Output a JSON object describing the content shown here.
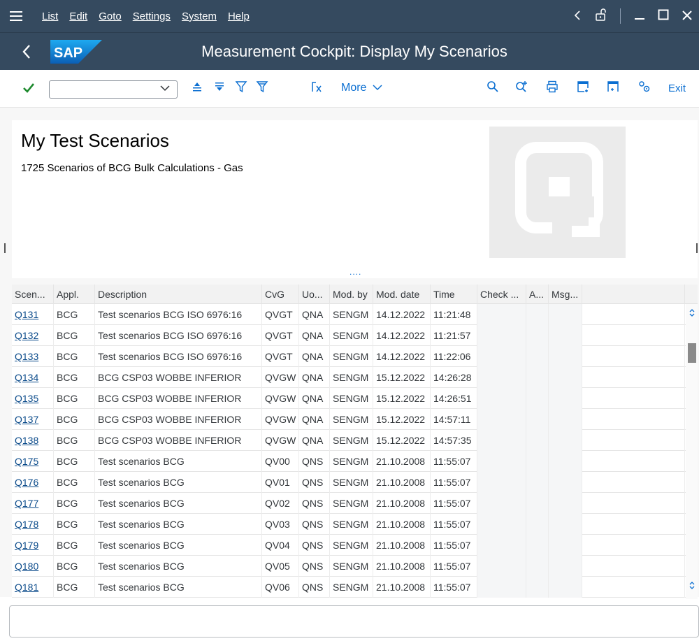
{
  "menu": {
    "items": [
      "List",
      "Edit",
      "Goto",
      "Settings",
      "System",
      "Help"
    ]
  },
  "title": "Measurement Cockpit: Display My Scenarios",
  "toolbar": {
    "more_label": "More",
    "exit_label": "Exit",
    "command_value": ""
  },
  "header": {
    "title": "My Test Scenarios",
    "subtitle": "1725 Scenarios of BCG Bulk Calculations - Gas",
    "splitter_glyph": "...."
  },
  "table": {
    "columns": [
      "Scen...",
      "Appl.",
      "Description",
      "CvG",
      "Uo...",
      "Mod. by",
      "Mod. date",
      "Time",
      "Check ...",
      "A...",
      "Msg...",
      ""
    ],
    "rows": [
      [
        "Q131",
        "BCG",
        "Test scenarios BCG ISO 6976:16",
        "QVGT",
        "QNA",
        "SENGM",
        "14.12.2022",
        "11:21:48"
      ],
      [
        "Q132",
        "BCG",
        "Test scenarios BCG ISO 6976:16",
        "QVGT",
        "QNA",
        "SENGM",
        "14.12.2022",
        "11:21:57"
      ],
      [
        "Q133",
        "BCG",
        "Test scenarios BCG ISO 6976:16",
        "QVGT",
        "QNA",
        "SENGM",
        "14.12.2022",
        "11:22:06"
      ],
      [
        "Q134",
        "BCG",
        "BCG CSP03 WOBBE INFERIOR",
        "QVGW",
        "QNA",
        "SENGM",
        "15.12.2022",
        "14:26:28"
      ],
      [
        "Q135",
        "BCG",
        "BCG CSP03 WOBBE INFERIOR",
        "QVGW",
        "QNA",
        "SENGM",
        "15.12.2022",
        "14:26:51"
      ],
      [
        "Q137",
        "BCG",
        "BCG CSP03 WOBBE INFERIOR",
        "QVGW",
        "QNA",
        "SENGM",
        "15.12.2022",
        "14:57:11"
      ],
      [
        "Q138",
        "BCG",
        "BCG CSP03 WOBBE INFERIOR",
        "QVGW",
        "QNA",
        "SENGM",
        "15.12.2022",
        "14:57:35"
      ],
      [
        "Q175",
        "BCG",
        "Test scenarios BCG",
        "QV00",
        "QNS",
        "SENGM",
        "21.10.2008",
        "11:55:07"
      ],
      [
        "Q176",
        "BCG",
        "Test scenarios BCG",
        "QV01",
        "QNS",
        "SENGM",
        "21.10.2008",
        "11:55:07"
      ],
      [
        "Q177",
        "BCG",
        "Test scenarios BCG",
        "QV02",
        "QNS",
        "SENGM",
        "21.10.2008",
        "11:55:07"
      ],
      [
        "Q178",
        "BCG",
        "Test scenarios BCG",
        "QV03",
        "QNS",
        "SENGM",
        "21.10.2008",
        "11:55:07"
      ],
      [
        "Q179",
        "BCG",
        "Test scenarios BCG",
        "QV04",
        "QNS",
        "SENGM",
        "21.10.2008",
        "11:55:07"
      ],
      [
        "Q180",
        "BCG",
        "Test scenarios BCG",
        "QV05",
        "QNS",
        "SENGM",
        "21.10.2008",
        "11:55:07"
      ],
      [
        "Q181",
        "BCG",
        "Test scenarios BCG",
        "QV06",
        "QNS",
        "SENGM",
        "21.10.2008",
        "11:55:07"
      ]
    ]
  },
  "colors": {
    "shell": "#354a5f",
    "accent": "#0a6ed1",
    "confirm": "#1e8a2e"
  },
  "icons": {
    "menu": "hamburger-icon",
    "confirm": "checkmark-icon",
    "sort_asc": "sort-ascending-icon",
    "sort_desc": "sort-descending-icon",
    "filter": "filter-icon",
    "filter_settings": "filter-settings-icon",
    "formula": "formula-icon",
    "search": "search-icon",
    "search_next": "search-next-icon",
    "print": "print-icon",
    "export": "export-icon",
    "layout": "layout-icon",
    "settings": "settings-icon"
  }
}
